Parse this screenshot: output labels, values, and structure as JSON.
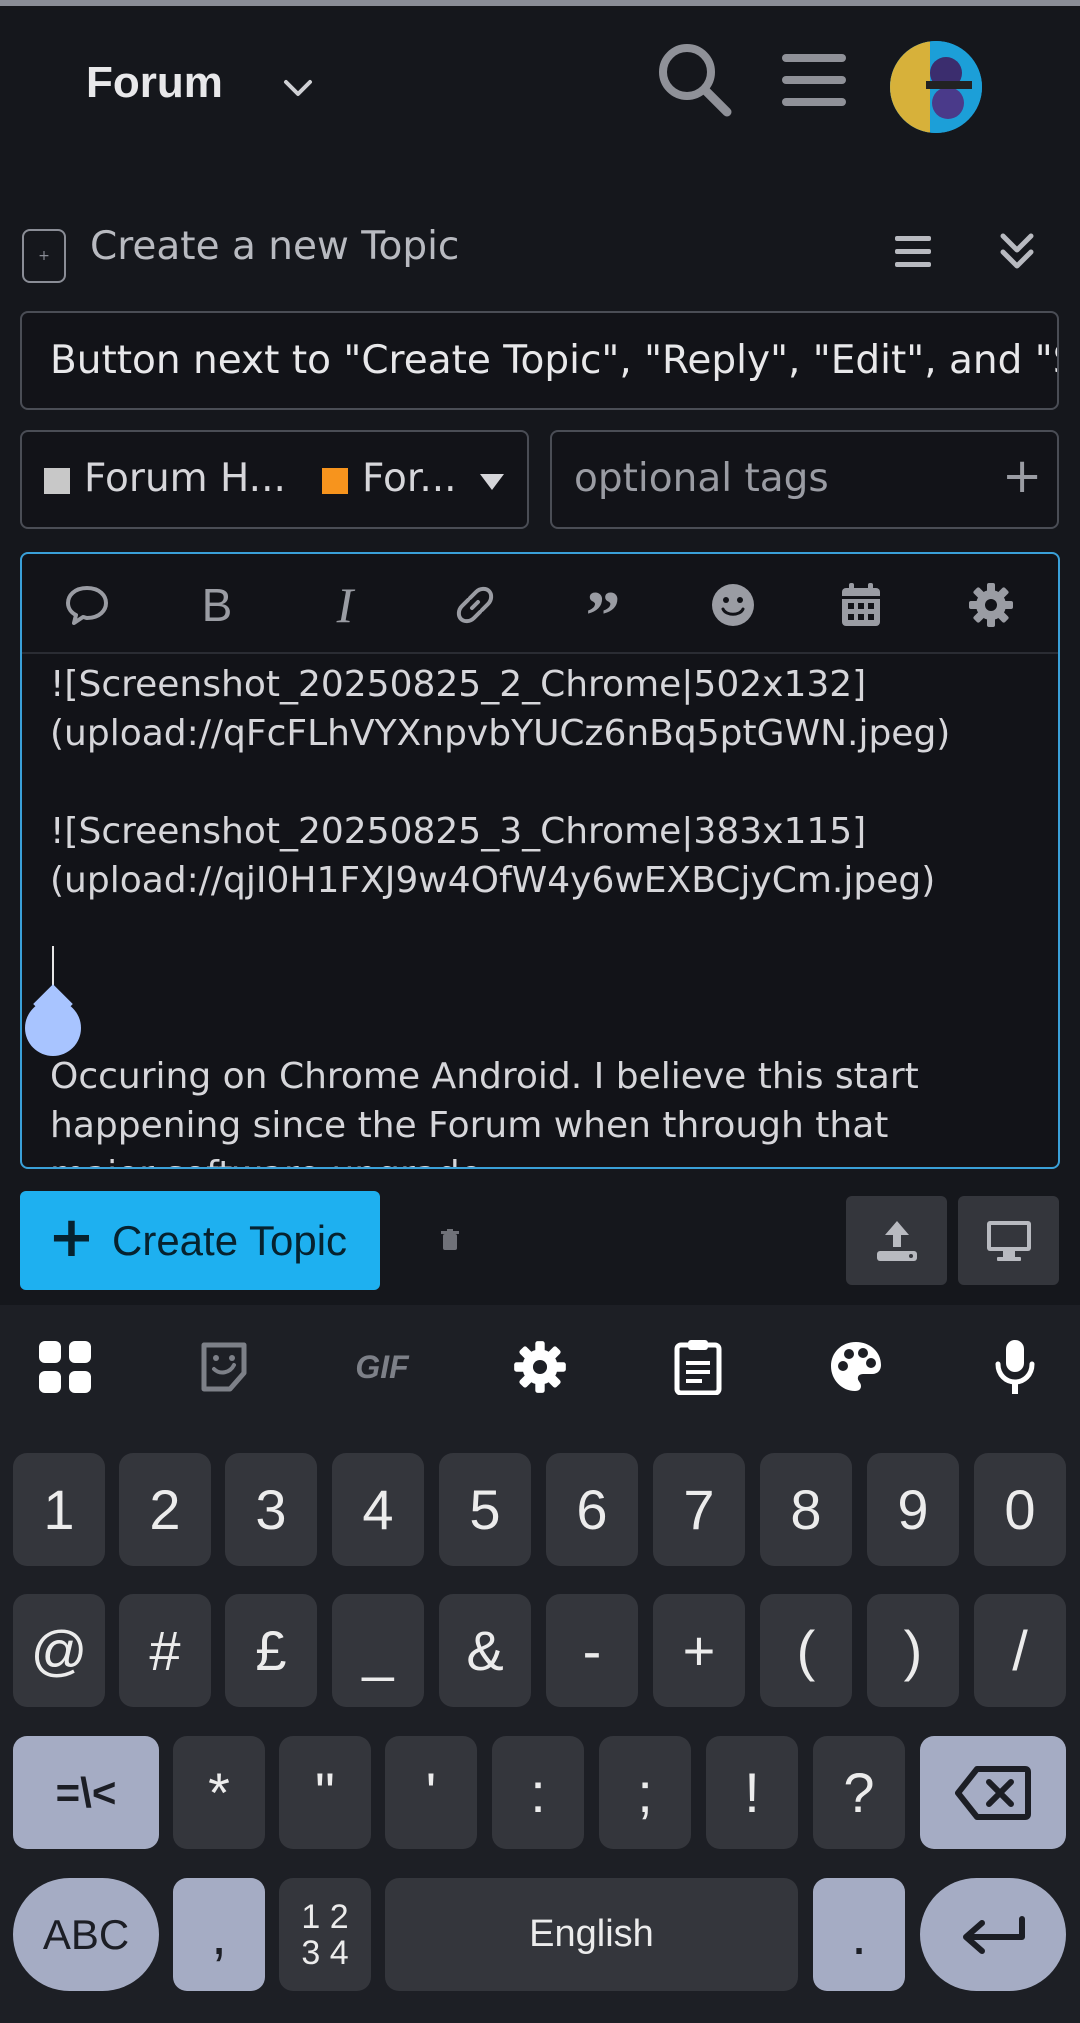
{
  "header": {
    "title": "Forum"
  },
  "composer": {
    "action_label": "Create a new Topic",
    "title_value": "Button next to \"Create Topic\", \"Reply\", \"Edit\", and \"Se",
    "category_parent": "Forum H...",
    "category_child": "For...",
    "category_parent_color": "#c8c8c8",
    "category_child_color": "#f7941d",
    "tags_placeholder": "optional tags",
    "editor_lines": [
      "![Screenshot_20250825_2_Chrome|502x132]",
      "(upload://qFcFLhVYXnpvbYUCz6nBq5ptGWN.jpeg)",
      "",
      "![Screenshot_20250825_3_Chrome|383x115]",
      "(upload://qjI0H1FXJ9w4OfW4y6wEXBCjyCm.jpeg)",
      "",
      "",
      "",
      "Occuring on Chrome Android. I believe this start",
      "happening since the Forum when through that",
      "major software upgrade"
    ],
    "submit_label": "Create Topic",
    "accent_color": "#1eb0f0"
  },
  "keyboard": {
    "toolbar_icons": [
      "apps-grid-icon",
      "sticker-icon",
      "gif-icon",
      "settings-icon",
      "clipboard-icon",
      "palette-icon",
      "microphone-icon"
    ],
    "gif_label": "GIF",
    "row1": [
      "1",
      "2",
      "3",
      "4",
      "5",
      "6",
      "7",
      "8",
      "9",
      "0"
    ],
    "row2": [
      "@",
      "#",
      "£",
      "_",
      "&",
      "-",
      "+",
      "(",
      ")",
      "/"
    ],
    "row3": [
      "=\\<",
      "*",
      "\"",
      "'",
      ":",
      ";",
      "!",
      "?"
    ],
    "abc_label": "ABC",
    "comma": ",",
    "numpad_top": "1 2",
    "numpad_bottom": "3 4",
    "space_label": "English",
    "period": "."
  }
}
